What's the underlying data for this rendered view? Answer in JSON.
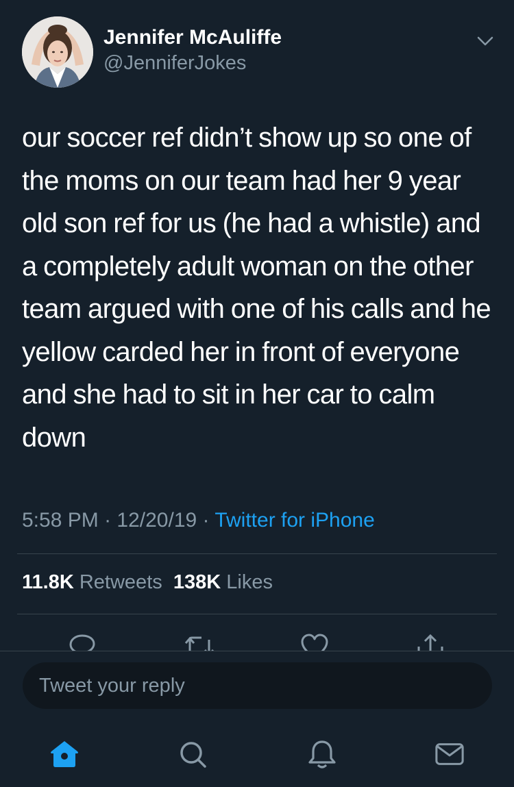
{
  "author": {
    "name": "Jennifer McAuliffe",
    "handle": "@JenniferJokes",
    "avatar_icon": "profile-photo"
  },
  "tweet": {
    "text": "our soccer ref didn’t show up so one of the moms on our team had her 9 year old son ref for us (he had a whistle) and a completely adult woman on the other team argued with one of his calls and he yellow carded her in front of everyone and she had to sit in her car to calm down",
    "time": "5:58 PM",
    "date": "12/20/19",
    "separator": "·",
    "source": "Twitter for iPhone"
  },
  "stats": {
    "retweets_count": "11.8K",
    "retweets_label": "Retweets",
    "likes_count": "138K",
    "likes_label": "Likes"
  },
  "actions": [
    "reply-icon",
    "retweet-icon",
    "like-icon",
    "share-icon"
  ],
  "reply": {
    "placeholder": "Tweet your reply"
  },
  "nav": [
    "home-icon",
    "search-icon",
    "notifications-icon",
    "messages-icon"
  ],
  "colors": {
    "background": "#15202b",
    "text": "#ffffff",
    "secondary": "#8899a6",
    "accent": "#1da1f2",
    "divider": "#38444d",
    "input_bg": "#10171e"
  }
}
